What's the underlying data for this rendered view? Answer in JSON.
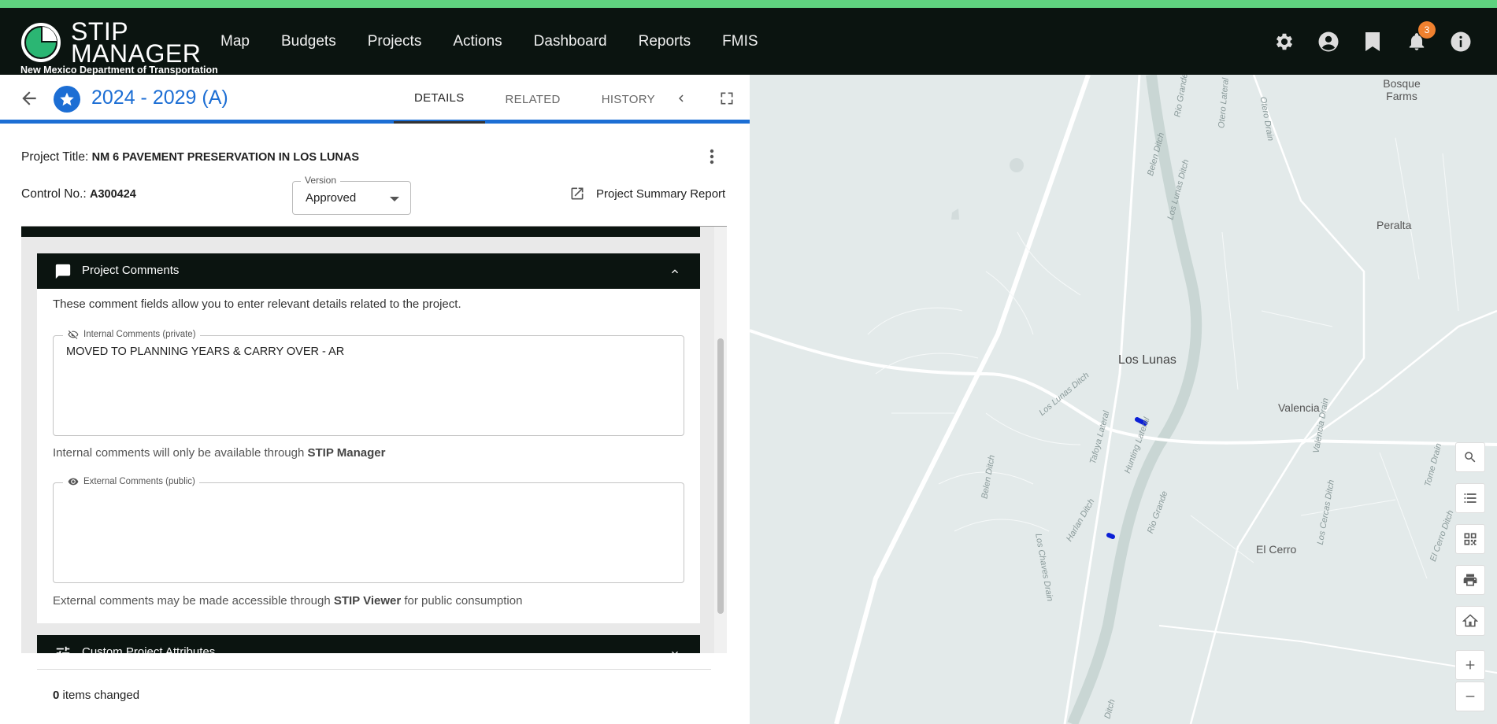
{
  "app": {
    "logo_line1": "STIP",
    "logo_line2": "MANAGER",
    "logo_sub": "New Mexico Department of Transportation",
    "nav": [
      "Map",
      "Budgets",
      "Projects",
      "Actions",
      "Dashboard",
      "Reports",
      "FMIS"
    ],
    "notification_count": "3",
    "icons": [
      "gear-icon",
      "account-circle-icon",
      "bookmark-icon",
      "bell-icon",
      "info-icon"
    ]
  },
  "header": {
    "stip_title": "2024 - 2029 (A)",
    "tabs": [
      {
        "label": "DETAILS",
        "active": true
      },
      {
        "label": "RELATED",
        "active": false
      },
      {
        "label": "HISTORY",
        "active": false
      }
    ]
  },
  "project": {
    "title_label": "Project Title:",
    "title_value": "NM 6 PAVEMENT PRESERVATION IN LOS LUNAS",
    "control_label": "Control No.:",
    "control_value": "A300424",
    "version_label": "Version",
    "version_value": "Approved",
    "summary_link": "Project Summary Report"
  },
  "comments_section": {
    "title": "Project Comments",
    "description": "These comment fields allow you to enter relevant details related to the project.",
    "internal": {
      "label": "Internal Comments (private)",
      "value": "MOVED TO PLANNING YEARS & CARRY OVER - AR",
      "helper_prefix": "Internal comments will only be available through ",
      "helper_strong": "STIP Manager",
      "helper_suffix": ""
    },
    "external": {
      "label": "External Comments (public)",
      "value": "",
      "helper_prefix": "External comments may be made accessible through ",
      "helper_strong": "STIP Viewer",
      "helper_suffix": " for public consumption"
    }
  },
  "next_section": {
    "title": "Custom Project Attributes"
  },
  "footer": {
    "count": "0",
    "text": " items changed"
  },
  "map": {
    "labels": [
      "Bosque Farms",
      "Peralta",
      "Los Lunas",
      "Valencia",
      "El Cerro"
    ],
    "road_labels": [
      "Rio Grande",
      "Otero Lateral",
      "Otero Drain",
      "Belen Ditch",
      "Los Lunas Ditch",
      "Los Lunas Ditch",
      "Tafoya Lateral",
      "Hunting Lateral",
      "Valencia Drain",
      "Tome Drain",
      "Harlan Ditch",
      "Rio Grande",
      "Los Cercas Ditch",
      "Belen Ditch",
      "Los Chaves Drain",
      "El Cerro Ditch",
      "Ditch"
    ],
    "controls": [
      "search-icon",
      "list-icon",
      "qr-code-icon",
      "print-icon",
      "home-icon",
      "zoom-in-icon",
      "zoom-out-icon"
    ],
    "colors": {
      "project_marker": "#0b1fd6",
      "water": "#c9d6d4",
      "roads": "#ffffff"
    }
  }
}
